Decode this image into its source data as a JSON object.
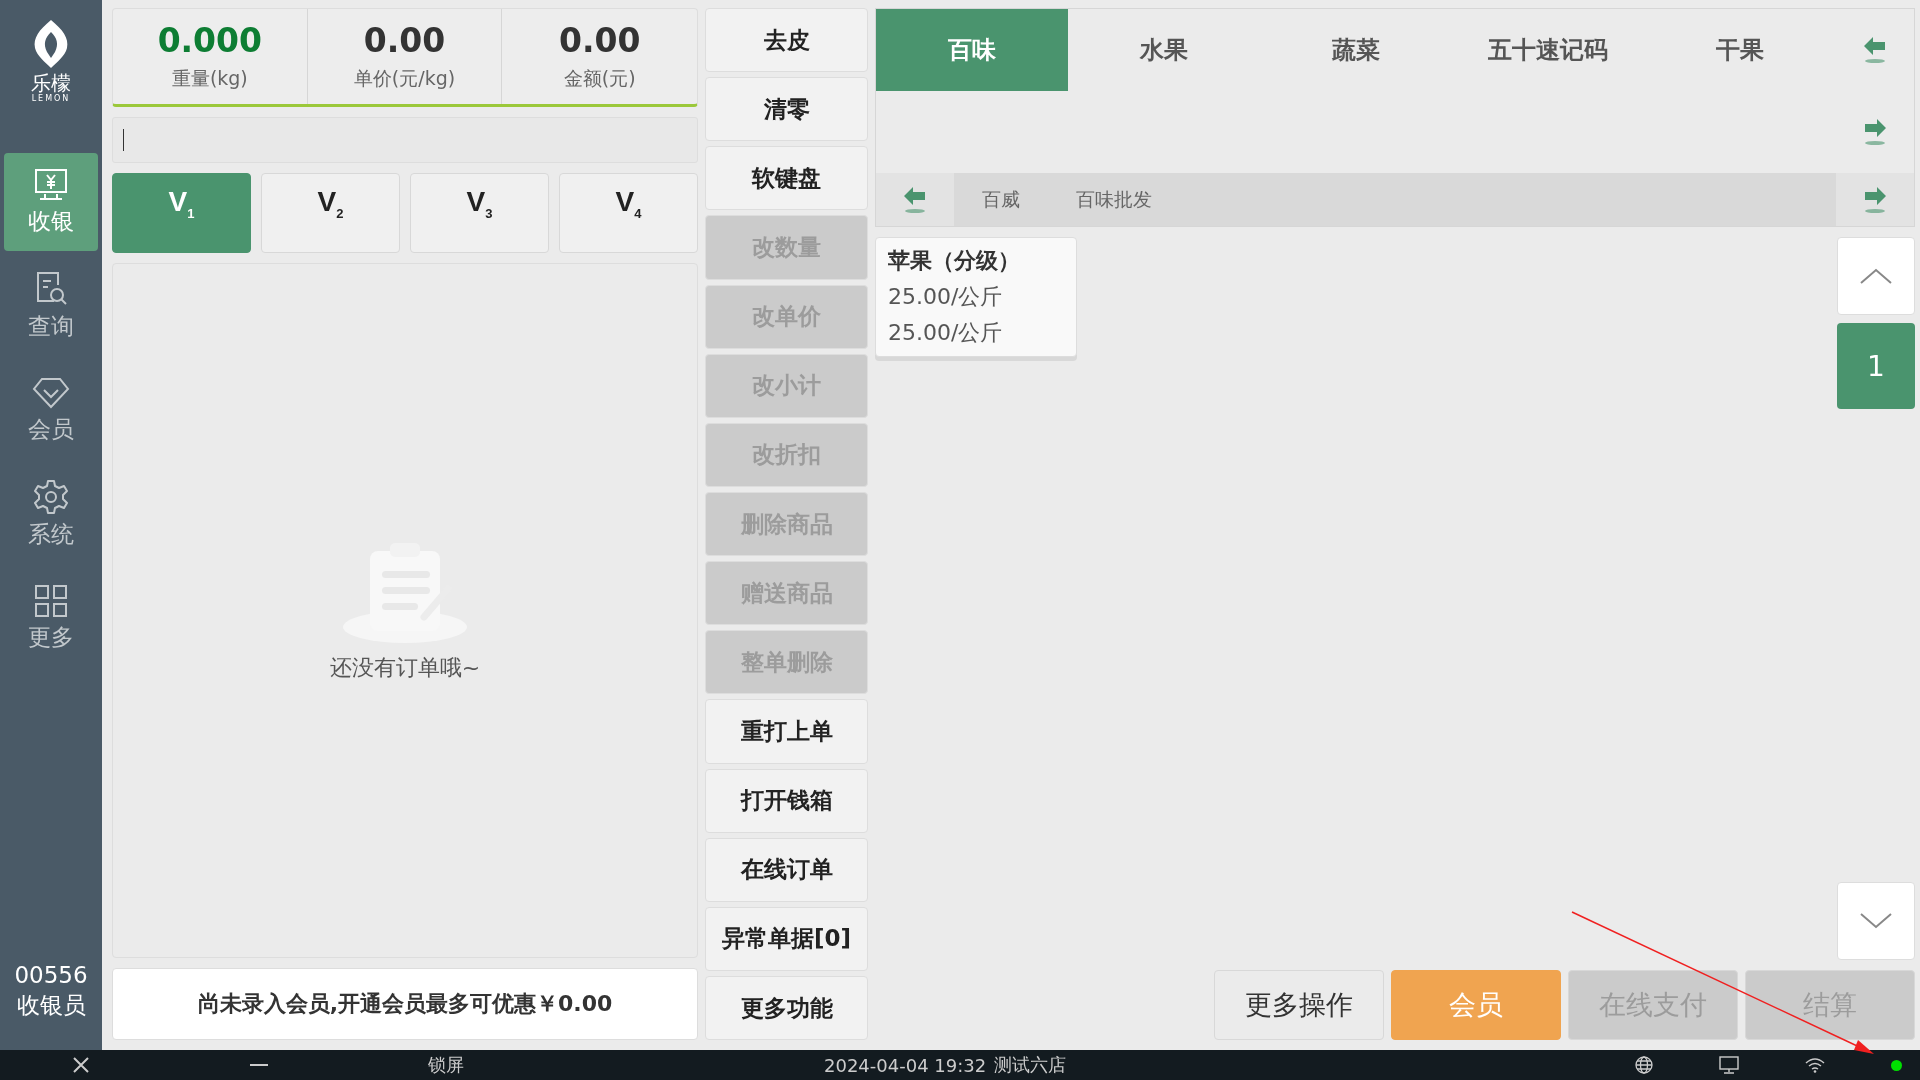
{
  "sidebar": {
    "logo": {
      "name": "乐檬",
      "tagline": "LEMON"
    },
    "items": [
      {
        "label": "收银",
        "kind": "register",
        "selected": true
      },
      {
        "label": "查询",
        "kind": "search",
        "selected": false
      },
      {
        "label": "会员",
        "kind": "diamond",
        "selected": false
      },
      {
        "label": "系统",
        "kind": "gear",
        "selected": false
      },
      {
        "label": "更多",
        "kind": "grid",
        "selected": false
      }
    ],
    "cashier": {
      "id": "00556",
      "role": "收银员"
    }
  },
  "scale": [
    {
      "value": "0.000",
      "label": "重量(kg)",
      "kind": "weight"
    },
    {
      "value": "0.00",
      "label": "单价(元/kg)",
      "kind": "money"
    },
    {
      "value": "0.00",
      "label": "金额(元)",
      "kind": "money"
    }
  ],
  "input": {
    "focused": true
  },
  "vip_buttons": [
    {
      "label": "V$_{1}$",
      "selected": true
    },
    {
      "label": "V$_{2}$",
      "selected": false
    },
    {
      "label": "V$_{3}$",
      "selected": false
    },
    {
      "label": "V$_{4}$",
      "selected": false
    }
  ],
  "empty_state": "还没有订单哦~",
  "member_banner": "尚未录入会员,开通会员最多可优惠￥0.00",
  "actions": [
    {
      "label": "去皮",
      "disabled": false
    },
    {
      "label": "清零",
      "disabled": false
    },
    {
      "label": "软键盘",
      "disabled": false
    },
    {
      "label": "改数量",
      "disabled": true
    },
    {
      "label": "改单价",
      "disabled": true
    },
    {
      "label": "改小计",
      "disabled": true
    },
    {
      "label": "改折扣",
      "disabled": true
    },
    {
      "label": "删除商品",
      "disabled": true
    },
    {
      "label": "赠送商品",
      "disabled": true
    },
    {
      "label": "整单删除",
      "disabled": true
    },
    {
      "label": "重打上单",
      "disabled": false
    },
    {
      "label": "打开钱箱",
      "disabled": false
    },
    {
      "label": "在线订单",
      "disabled": false
    },
    {
      "label": "异常单据[0]",
      "disabled": false
    },
    {
      "label": "更多功能",
      "disabled": false
    }
  ],
  "categories": [
    {
      "label": "百味",
      "selected": true
    },
    {
      "label": "水果",
      "selected": false
    },
    {
      "label": "蔬菜",
      "selected": false
    },
    {
      "label": "五十速记码",
      "selected": false
    },
    {
      "label": "干果",
      "selected": false
    }
  ],
  "subcategories": [
    "百威",
    "百味批发"
  ],
  "products": [
    {
      "name": "苹果（分级）",
      "price": "25.00/公斤",
      "member_price": "25.00/公斤"
    }
  ],
  "pager": {
    "page": "1"
  },
  "bottom_buttons": [
    {
      "label": "更多操作",
      "kind": "default"
    },
    {
      "label": "会员",
      "kind": "accent"
    },
    {
      "label": "在线支付",
      "kind": "disabled"
    },
    {
      "label": "结算",
      "kind": "disabled"
    }
  ],
  "taskbar": {
    "lock": "锁屏",
    "datetime": "2024-04-04 19:32",
    "store": "测试六店",
    "status": {
      "color": "#00e000"
    }
  }
}
